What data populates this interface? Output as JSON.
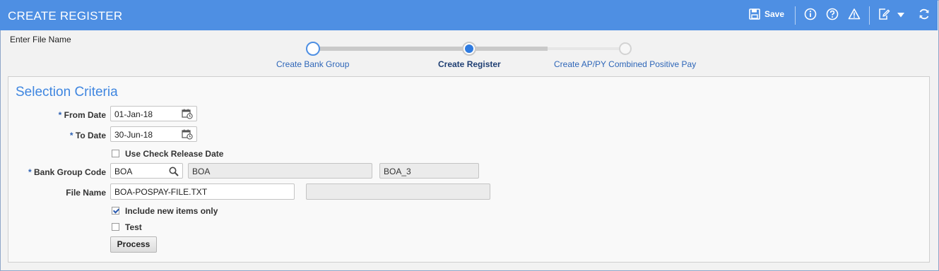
{
  "header": {
    "title": "CREATE REGISTER",
    "save_label": "Save",
    "icons": [
      "save-icon",
      "info-icon",
      "help-icon",
      "warning-icon",
      "edit-icon",
      "chevron-down-icon",
      "refresh-icon"
    ],
    "bg_color": "#4e8fe3"
  },
  "wizard": {
    "caption": "Enter File Name",
    "steps": [
      {
        "label": "Create Bank Group",
        "state": "complete"
      },
      {
        "label": "Create Register",
        "state": "current"
      },
      {
        "label": "Create AP/PY Combined Positive Pay",
        "state": "pending"
      }
    ]
  },
  "section": {
    "title": "Selection Criteria"
  },
  "form": {
    "from_date": {
      "label": "From Date",
      "required_mark": "*",
      "value": "01-Jan-18"
    },
    "to_date": {
      "label": "To Date",
      "required_mark": "*",
      "value": "30-Jun-18"
    },
    "use_check_release_date": {
      "label": "Use Check Release Date",
      "checked": false
    },
    "bank_group_code": {
      "label": "Bank Group Code",
      "required_mark": "*",
      "value": "BOA",
      "description": "BOA",
      "extra": "BOA_3"
    },
    "file_name": {
      "label": "File Name",
      "value": "BOA-POSPAY-FILE.TXT",
      "extra": ""
    },
    "include_new_items_only": {
      "label": "Include new items only",
      "checked": true
    },
    "test": {
      "label": "Test",
      "checked": false
    },
    "process_label": "Process"
  }
}
